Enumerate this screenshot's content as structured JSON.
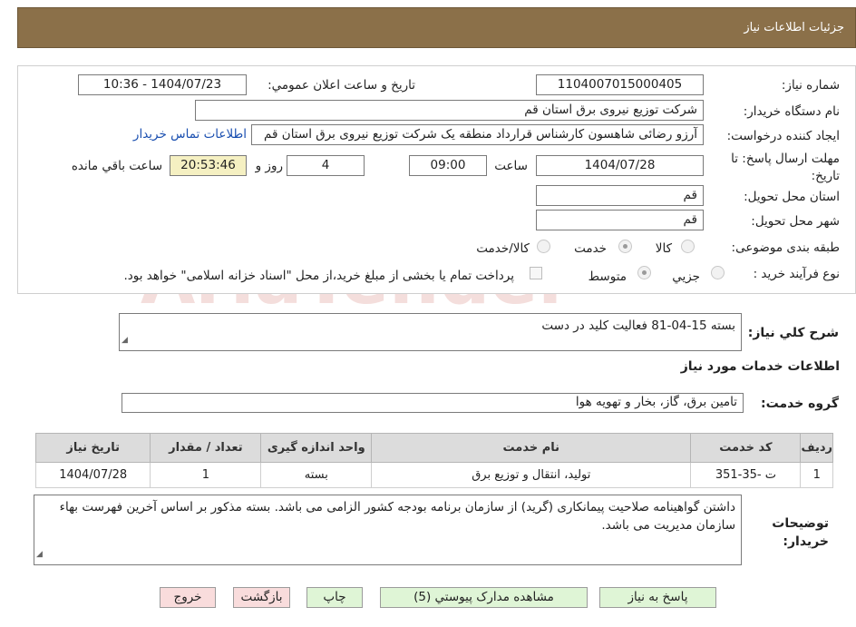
{
  "header": {
    "title": "جزئیات اطلاعات نیاز"
  },
  "form": {
    "need_number_label": "شماره نیاز:",
    "need_number": "1104007015000405",
    "announce_label": "تاریخ و ساعت اعلان عمومي:",
    "announce_value": "1404/07/23 - 10:36",
    "buyer_org_label": "نام دستگاه خریدار:",
    "buyer_org": "شرکت توزیع نیروی برق استان قم",
    "creator_label": "ایجاد کننده درخواست:",
    "creator": "آرزو رضائی شاهسون کارشناس قرارداد منطقه یک شرکت توزیع نیروی برق استان قم",
    "contact_link": "اطلاعات تماس خریدار",
    "deadline_label": "مهلت ارسال پاسخ: تا تاریخ:",
    "deadline_date": "1404/07/28",
    "time_label": "ساعت",
    "deadline_time": "09:00",
    "days": "4",
    "days_label": "روز و",
    "remaining_time": "20:53:46",
    "remaining_label": "ساعت باقي مانده",
    "province_label": "استان محل تحویل:",
    "province": "قم",
    "city_label": "شهر محل تحویل:",
    "city": "قم",
    "category_label": "طبقه بندی موضوعی:",
    "category_options": [
      "کالا",
      "خدمت",
      "کالا/خدمت"
    ],
    "category_selected": "خدمت",
    "process_label": "نوع فرآیند خرید :",
    "process_options": [
      "جزیي",
      "متوسط"
    ],
    "process_selected": "متوسط",
    "payment_note": "پرداخت تمام یا بخشی از مبلغ خرید،از محل \"اسناد خزانه اسلامی\" خواهد بود."
  },
  "summary": {
    "label": "شرح کلي نیاز:",
    "value": "بسته 15-04-81 فعالیت کلید در دست"
  },
  "services_section": {
    "title": "اطلاعات خدمات مورد نیاز",
    "group_label": "گروه خدمت:",
    "group_value": "تامین برق، گاز، بخار و تهویه هوا"
  },
  "table": {
    "headers": [
      "ردیف",
      "کد خدمت",
      "نام خدمت",
      "واحد اندازه گیری",
      "تعداد / مقدار",
      "تاریخ نیاز"
    ],
    "rows": [
      [
        "1",
        "ت -35-351",
        "تولید، انتقال و توزیع برق",
        "بسته",
        "1",
        "1404/07/28"
      ]
    ]
  },
  "buyer_notes": {
    "label": "توضیحات خریدار:",
    "value": "داشتن گواهینامه صلاحیت پیمانکاری (گرید) از سازمان برنامه بودجه کشور الزامی می باشد. بسته مذکور بر اساس آخرین فهرست بهاء سازمان مدیریت می باشد."
  },
  "buttons": {
    "reply": "پاسخ به نیاز",
    "attachments": "مشاهده مدارک پیوستي (5)",
    "print": "چاپ",
    "back": "بازگشت",
    "exit": "خروج"
  },
  "watermark": {
    "text": "AriaTender.neT"
  },
  "colors": {
    "header_bg": "#8b7049",
    "button_green": "#dff5d6",
    "button_pink": "#f9dcdc",
    "remaining_bg": "#f5f0c2",
    "link": "#1a4fb0"
  }
}
